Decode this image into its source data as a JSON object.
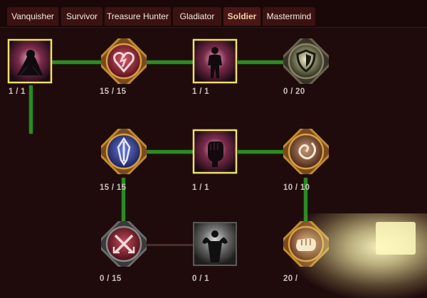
{
  "tabs": [
    {
      "label": "Vanquisher",
      "active": false
    },
    {
      "label": "Survivor",
      "active": false
    },
    {
      "label": "Treasure Hunter",
      "active": false
    },
    {
      "label": "Gladiator",
      "active": false
    },
    {
      "label": "Soldier",
      "active": true
    },
    {
      "label": "Mastermind",
      "active": false
    }
  ],
  "nodes": {
    "arm_wrestle": {
      "icon": "arm-wrestle-icon",
      "points": "1 / 1"
    },
    "heart_emblem": {
      "icon": "heart-emblem-icon",
      "points": "15 / 15"
    },
    "champion": {
      "icon": "champion-figure-icon",
      "points": "1 / 1"
    },
    "shield": {
      "icon": "shield-icon",
      "points": "0 / 20"
    },
    "sword_crest": {
      "icon": "sword-crest-icon",
      "points": "15 / 15"
    },
    "fist": {
      "icon": "raised-fist-icon",
      "points": "1 / 1"
    },
    "spiral": {
      "icon": "spiral-icon",
      "points": "10 / 10"
    },
    "crossed_swords": {
      "icon": "crossed-swords-icon",
      "points": "0 / 15"
    },
    "flexing_figure": {
      "icon": "flexing-figure-icon",
      "points": "0 / 1"
    },
    "punch": {
      "icon": "punch-fist-icon",
      "points": "20 /"
    }
  },
  "colors": {
    "background": "#1f0b0b",
    "tab": "#3b1212",
    "active_tab_text": "#f2d0a6",
    "link_active": "#2c8a24",
    "frame_gold": "#c08a2e",
    "square_frame": "#f0e06a"
  }
}
